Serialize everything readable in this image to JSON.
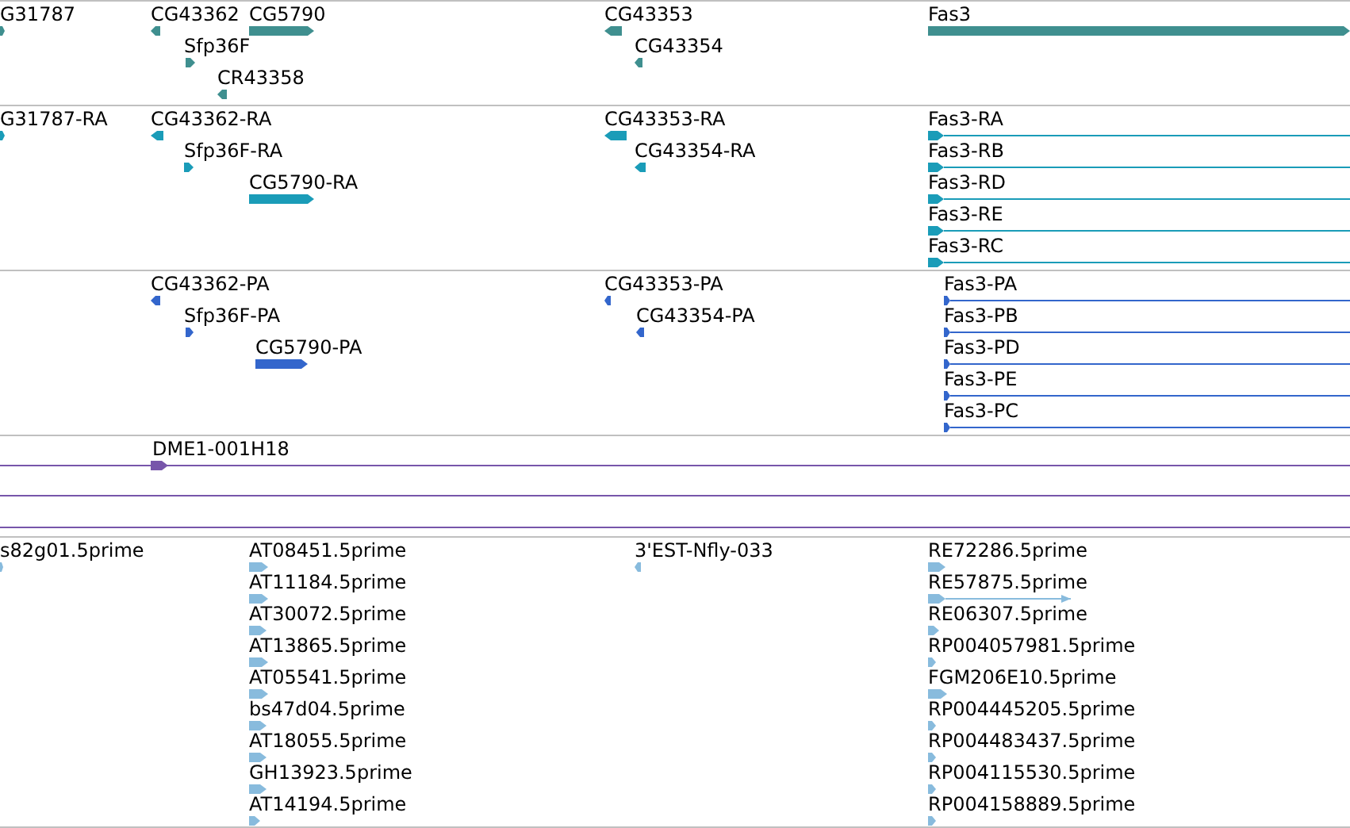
{
  "tracks": [
    {
      "color": "#3f8f8f",
      "features": [
        {
          "label": "G31787",
          "reverse": false
        },
        {
          "label": "CG43362",
          "reverse": true
        },
        {
          "label": "CG5790",
          "reverse": false
        },
        {
          "label": "Sfp36F",
          "reverse": false
        },
        {
          "label": "CR43358",
          "reverse": true
        },
        {
          "label": "CG43353",
          "reverse": true
        },
        {
          "label": "CG43354",
          "reverse": true
        },
        {
          "label": "Fas3",
          "reverse": false
        }
      ]
    },
    {
      "color": "#1a9cb8",
      "features": [
        {
          "label": "G31787-RA",
          "reverse": false
        },
        {
          "label": "CG43362-RA",
          "reverse": true
        },
        {
          "label": "Sfp36F-RA",
          "reverse": false
        },
        {
          "label": "CG5790-RA",
          "reverse": false
        },
        {
          "label": "CG43353-RA",
          "reverse": true
        },
        {
          "label": "CG43354-RA",
          "reverse": true
        },
        {
          "label": "Fas3-RA",
          "reverse": false
        },
        {
          "label": "Fas3-RB",
          "reverse": false
        },
        {
          "label": "Fas3-RD",
          "reverse": false
        },
        {
          "label": "Fas3-RE",
          "reverse": false
        },
        {
          "label": "Fas3-RC",
          "reverse": false
        }
      ]
    },
    {
      "color": "#3366cc",
      "features": [
        {
          "label": "CG43362-PA",
          "reverse": true
        },
        {
          "label": "Sfp36F-PA",
          "reverse": false
        },
        {
          "label": "CG5790-PA",
          "reverse": false
        },
        {
          "label": "CG43353-PA",
          "reverse": true
        },
        {
          "label": "CG43354-PA",
          "reverse": true
        },
        {
          "label": "Fas3-PA",
          "reverse": false
        },
        {
          "label": "Fas3-PB",
          "reverse": false
        },
        {
          "label": "Fas3-PD",
          "reverse": false
        },
        {
          "label": "Fas3-PE",
          "reverse": false
        },
        {
          "label": "Fas3-PC",
          "reverse": false
        }
      ]
    },
    {
      "color": "#7755aa",
      "features": [
        {
          "label": "DME1-001H18",
          "reverse": false
        }
      ]
    },
    {
      "color": "#88bbdd",
      "features": [
        {
          "label": "s82g01.5prime",
          "reverse": false
        },
        {
          "label": "AT08451.5prime",
          "reverse": false
        },
        {
          "label": "AT11184.5prime",
          "reverse": false
        },
        {
          "label": "AT30072.5prime",
          "reverse": false
        },
        {
          "label": "AT13865.5prime",
          "reverse": false
        },
        {
          "label": "AT05541.5prime",
          "reverse": false
        },
        {
          "label": "bs47d04.5prime",
          "reverse": false
        },
        {
          "label": "AT18055.5prime",
          "reverse": false
        },
        {
          "label": "GH13923.5prime",
          "reverse": false
        },
        {
          "label": "AT14194.5prime",
          "reverse": false
        },
        {
          "label": "3'EST-Nfly-033",
          "reverse": true
        },
        {
          "label": "RE72286.5prime",
          "reverse": false
        },
        {
          "label": "RE57875.5prime",
          "reverse": false
        },
        {
          "label": "RE06307.5prime",
          "reverse": false
        },
        {
          "label": "RP004057981.5prime",
          "reverse": false
        },
        {
          "label": "FGM206E10.5prime",
          "reverse": false
        },
        {
          "label": "RP004445205.5prime",
          "reverse": false
        },
        {
          "label": "RP004483437.5prime",
          "reverse": false
        },
        {
          "label": "RP004115530.5prime",
          "reverse": false
        },
        {
          "label": "RP004158889.5prime",
          "reverse": false
        }
      ]
    }
  ]
}
